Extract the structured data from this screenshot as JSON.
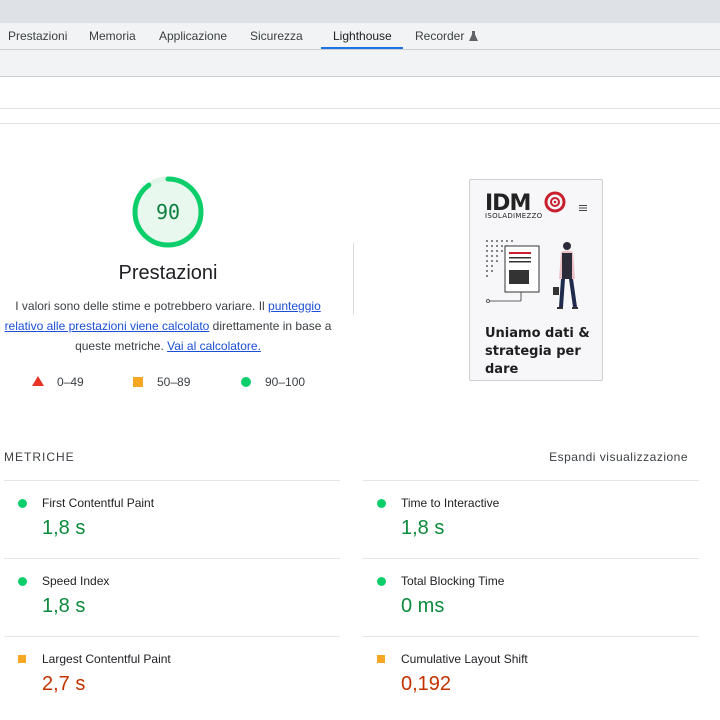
{
  "devtools": {
    "tabs": [
      {
        "label": "Prestazioni"
      },
      {
        "label": "Memoria"
      },
      {
        "label": "Applicazione"
      },
      {
        "label": "Sicurezza"
      },
      {
        "label": "Lighthouse",
        "active": true
      },
      {
        "label": "Recorder",
        "icon": "flask-icon"
      }
    ]
  },
  "performance": {
    "score": "90",
    "score_fraction": 0.9,
    "title": "Prestazioni",
    "description": {
      "part1": "I valori sono delle stime e potrebbero variare. Il ",
      "link1": "punteggio relativo alle prestazioni viene calcolato",
      "part2": " direttamente in base a queste metriche. ",
      "link2": "Vai al calcolatore."
    },
    "legend": [
      {
        "range": "0–49",
        "icon": "triangle-icon",
        "color": "#eb3323"
      },
      {
        "range": "50–89",
        "icon": "square-icon",
        "color": "#f5a623"
      },
      {
        "range": "90–100",
        "icon": "circle-icon",
        "color": "#0cce6b"
      }
    ]
  },
  "screenshot": {
    "logo": "IDMO",
    "logo_sub": "ISOLADIMEZZO",
    "menu_icon": "hamburger-icon",
    "headline": "Uniamo dati & strategia per dare"
  },
  "metrics_section": {
    "title": "METRICHE",
    "toggle": "Espandi visualizzazione",
    "items": [
      {
        "name": "First Contentful Paint",
        "value": "1,8 s",
        "status": "pass"
      },
      {
        "name": "Time to Interactive",
        "value": "1,8 s",
        "status": "pass"
      },
      {
        "name": "Speed Index",
        "value": "1,8 s",
        "status": "pass"
      },
      {
        "name": "Total Blocking Time",
        "value": "0 ms",
        "status": "pass"
      },
      {
        "name": "Largest Contentful Paint",
        "value": "2,7 s",
        "status": "average"
      },
      {
        "name": "Cumulative Layout Shift",
        "value": "0,192",
        "status": "average"
      }
    ]
  },
  "colors": {
    "pass": "#0cce6b",
    "average": "#f5a623",
    "fail": "#eb3323",
    "accent": "#1a73e8"
  }
}
